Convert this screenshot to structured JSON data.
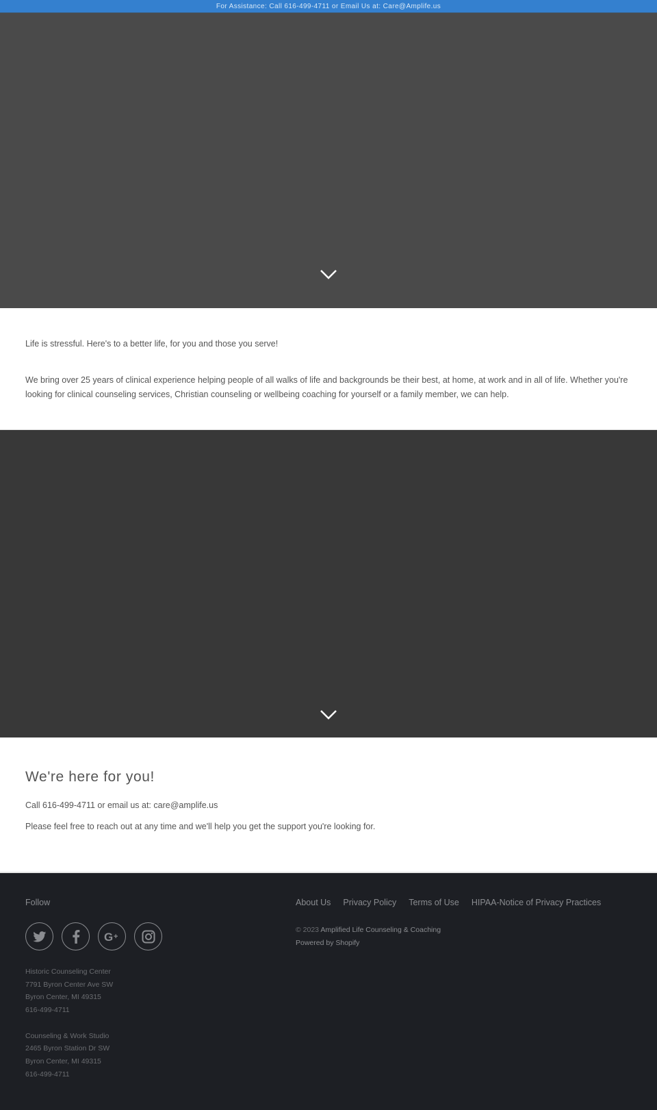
{
  "topbar": {
    "text": "For Assistance: Call 616-499-4711 or Email Us at: Care@Amplife.us"
  },
  "intro": {
    "lead": "Life is stressful. Here's to a better life, for you and those you serve!",
    "body": "We bring over 25 years of clinical experience helping people of all walks of life and backgrounds be their best, at home, at work and in all of life. Whether you're looking for clinical counseling services, Christian counseling or wellbeing coaching for yourself or a family member, we can help."
  },
  "contact": {
    "heading": "We're here for you!",
    "line1": "Call 616-499-4711 or email us at: care@amplife.us",
    "line2": "Please feel free to reach out at any time and we'll help you get the support you're looking for."
  },
  "footer": {
    "follow_label": "Follow",
    "social": [
      {
        "name": "twitter",
        "icon": "twitter-icon"
      },
      {
        "name": "facebook",
        "icon": "facebook-icon"
      },
      {
        "name": "google-plus",
        "icon": "google-plus-icon"
      },
      {
        "name": "instagram",
        "icon": "instagram-icon"
      }
    ],
    "locations": [
      {
        "name": "Historic Counseling Center",
        "street": "7791 Byron Center Ave SW",
        "city": "Byron Center, MI 49315",
        "phone": "616-499-4711"
      },
      {
        "name": "Counseling & Work Studio",
        "street": "2465 Byron Station Dr SW",
        "city": "Byron Center, MI 49315",
        "phone": "616-499-4711"
      }
    ],
    "links": [
      "About Us",
      "Privacy Policy",
      "Terms of Use",
      "HIPAA-Notice of Privacy Practices"
    ],
    "copyright_prefix": "© 2023",
    "brand": "Amplified Life Counseling & Coaching",
    "powered": "Powered by Shopify"
  },
  "colors": {
    "topbar": "#3480cf",
    "hero1": "#4a4a4a",
    "hero2": "#383838",
    "footer": "#1d1f24"
  }
}
